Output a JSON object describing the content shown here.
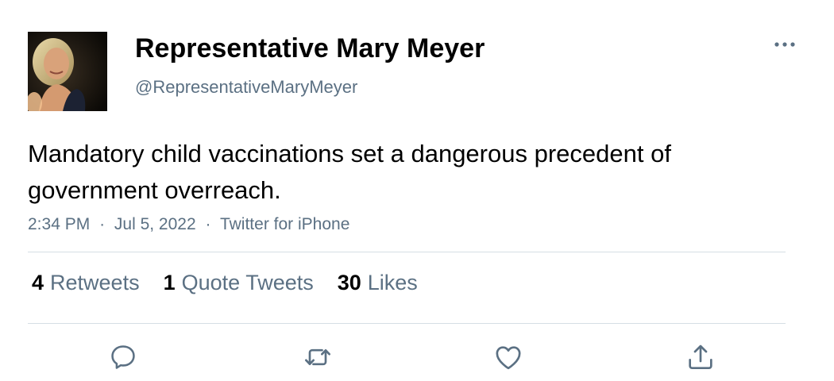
{
  "tweet": {
    "display_name": "Representative Mary Meyer",
    "handle": "@RepresentativeMaryMeyer",
    "text": "Mandatory child vaccinations set a dangerous precedent of government overreach.",
    "time": "2:34 PM",
    "date": "Jul 5, 2022",
    "source": "Twitter for iPhone",
    "separator": "·"
  },
  "stats": {
    "retweets": {
      "count": "4",
      "label": "Retweets"
    },
    "quotes": {
      "count": "1",
      "label": "Quote Tweets"
    },
    "likes": {
      "count": "30",
      "label": "Likes"
    }
  },
  "icons": {
    "more": "more-dots-icon",
    "reply": "reply-icon",
    "retweet": "retweet-icon",
    "like": "like-icon",
    "share": "share-icon"
  },
  "colors": {
    "text": "#000000",
    "secondary": "#5b7083",
    "divider": "#d6dee4"
  }
}
